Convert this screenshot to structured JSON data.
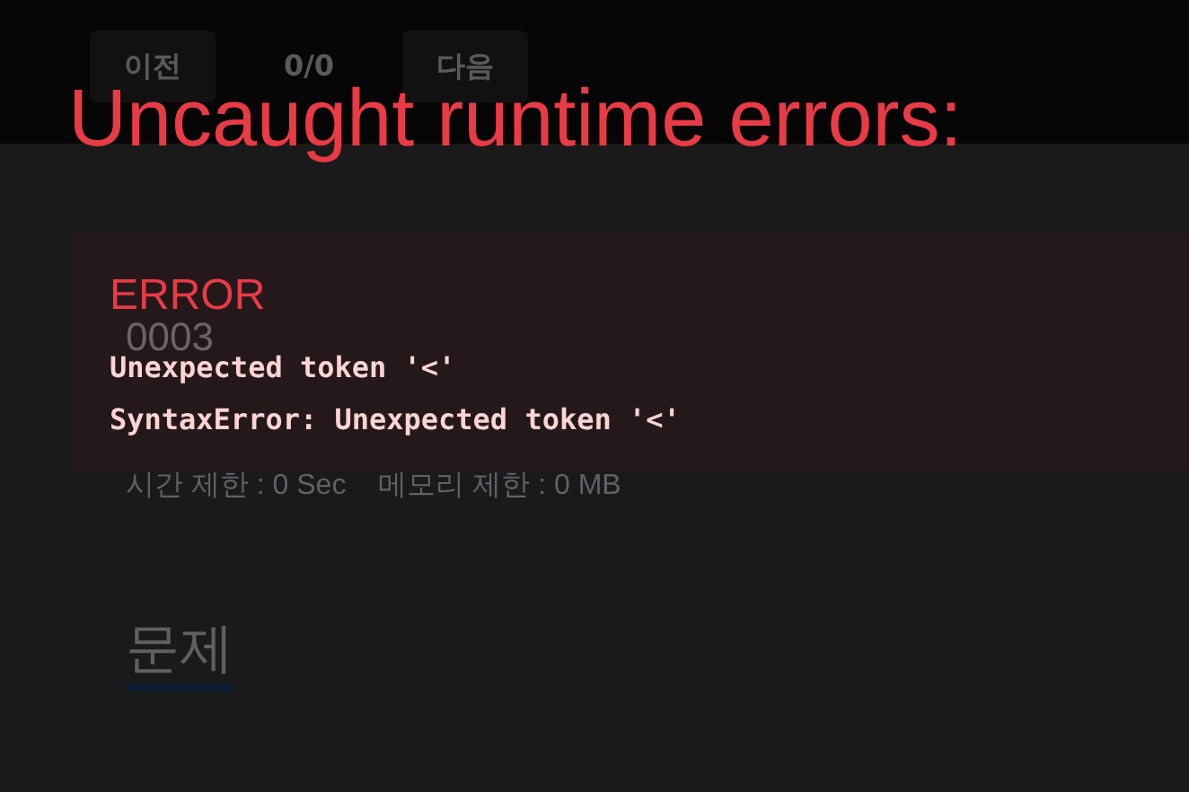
{
  "page": {
    "nav": {
      "prev_button": "이전",
      "counter": "0/0",
      "next_button": "다음"
    },
    "problem_id": "0003",
    "limits": [
      "시간 제한 : 0 Sec",
      "메모리 제한 : 0 MB"
    ],
    "section_heading": "문제"
  },
  "error_overlay": {
    "title": "Uncaught runtime errors:",
    "errors": [
      {
        "label": "ERROR",
        "message": "Unexpected token '<'",
        "stack": "SyntaxError: Unexpected token '<'"
      }
    ]
  }
}
